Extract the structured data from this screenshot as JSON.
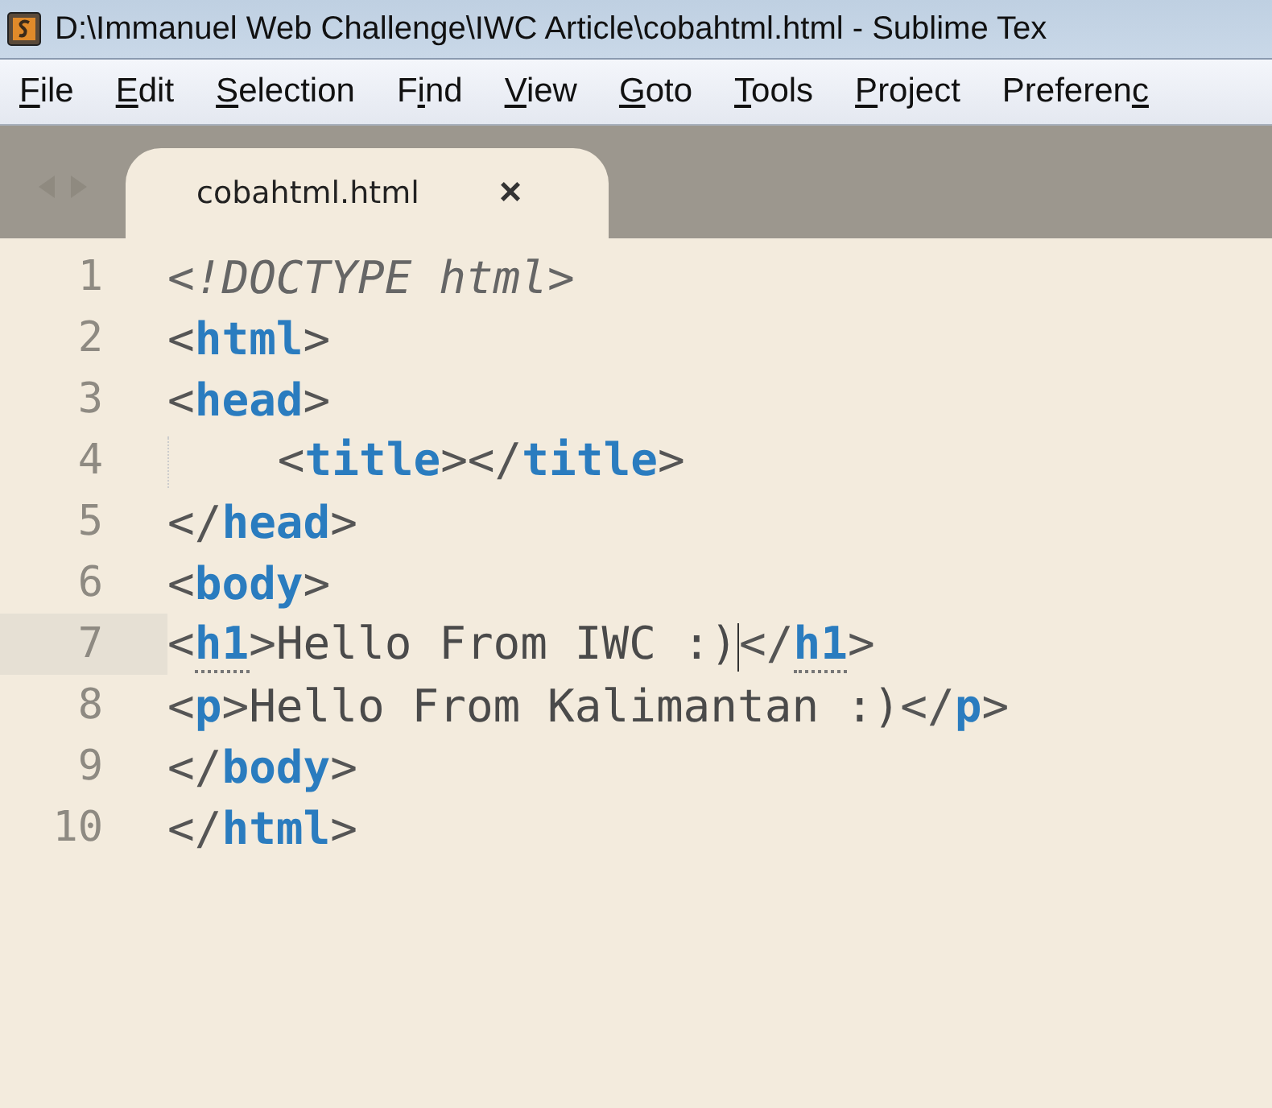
{
  "window": {
    "title": "D:\\Immanuel Web Challenge\\IWC Article\\cobahtml.html - Sublime Tex"
  },
  "menu": [
    {
      "key": "F",
      "rest": "ile"
    },
    {
      "key": "E",
      "rest": "dit"
    },
    {
      "key": "S",
      "rest": "election"
    },
    {
      "lead": "F",
      "key": "i",
      "rest": "nd"
    },
    {
      "key": "V",
      "rest": "iew"
    },
    {
      "key": "G",
      "rest": "oto"
    },
    {
      "key": "T",
      "rest": "ools"
    },
    {
      "key": "P",
      "rest": "roject"
    },
    {
      "lead": "Preferen",
      "key": "c"
    }
  ],
  "tabs": [
    {
      "label": "cobahtml.html",
      "selected": true,
      "close": "×"
    }
  ],
  "editor": {
    "lines": [
      {
        "number": "1",
        "current": false,
        "tokens": [
          {
            "kind": "doctype",
            "text": "<!DOCTYPE html>"
          }
        ]
      },
      {
        "number": "2",
        "current": false,
        "tokens": [
          {
            "kind": "punct",
            "text": "<"
          },
          {
            "kind": "tag",
            "text": "html"
          },
          {
            "kind": "punct",
            "text": ">"
          }
        ]
      },
      {
        "number": "3",
        "current": false,
        "tokens": [
          {
            "kind": "punct",
            "text": "<"
          },
          {
            "kind": "tag",
            "text": "head"
          },
          {
            "kind": "punct",
            "text": ">"
          }
        ]
      },
      {
        "number": "4",
        "current": false,
        "tokens": [
          {
            "kind": "indent"
          },
          {
            "kind": "punct",
            "text": "<"
          },
          {
            "kind": "tag",
            "text": "title"
          },
          {
            "kind": "punct",
            "text": "></"
          },
          {
            "kind": "tag",
            "text": "title"
          },
          {
            "kind": "punct",
            "text": ">"
          }
        ]
      },
      {
        "number": "5",
        "current": false,
        "tokens": [
          {
            "kind": "punct",
            "text": "</"
          },
          {
            "kind": "tag",
            "text": "head"
          },
          {
            "kind": "punct",
            "text": ">"
          }
        ]
      },
      {
        "number": "6",
        "current": false,
        "tokens": [
          {
            "kind": "punct",
            "text": "<"
          },
          {
            "kind": "tag",
            "text": "body"
          },
          {
            "kind": "punct",
            "text": ">"
          }
        ]
      },
      {
        "number": "7",
        "current": true,
        "tokens": [
          {
            "kind": "punct",
            "text": "<"
          },
          {
            "kind": "matched",
            "text": "h1"
          },
          {
            "kind": "punct",
            "text": ">"
          },
          {
            "kind": "text",
            "text": "Hello From IWC :)"
          },
          {
            "kind": "cursor"
          },
          {
            "kind": "punct",
            "text": "</"
          },
          {
            "kind": "matched",
            "text": "h1"
          },
          {
            "kind": "punct",
            "text": ">"
          }
        ]
      },
      {
        "number": "8",
        "current": false,
        "tokens": [
          {
            "kind": "punct",
            "text": "<"
          },
          {
            "kind": "tag",
            "text": "p"
          },
          {
            "kind": "punct",
            "text": ">"
          },
          {
            "kind": "text",
            "text": "Hello From Kalimantan :)"
          },
          {
            "kind": "punct",
            "text": "</"
          },
          {
            "kind": "tag",
            "text": "p"
          },
          {
            "kind": "punct",
            "text": ">"
          }
        ]
      },
      {
        "number": "9",
        "current": false,
        "tokens": [
          {
            "kind": "punct",
            "text": "</"
          },
          {
            "kind": "tag",
            "text": "body"
          },
          {
            "kind": "punct",
            "text": ">"
          }
        ]
      },
      {
        "number": "10",
        "current": false,
        "tokens": [
          {
            "kind": "punct",
            "text": "</"
          },
          {
            "kind": "tag",
            "text": "html"
          },
          {
            "kind": "punct",
            "text": ">"
          }
        ]
      }
    ]
  }
}
